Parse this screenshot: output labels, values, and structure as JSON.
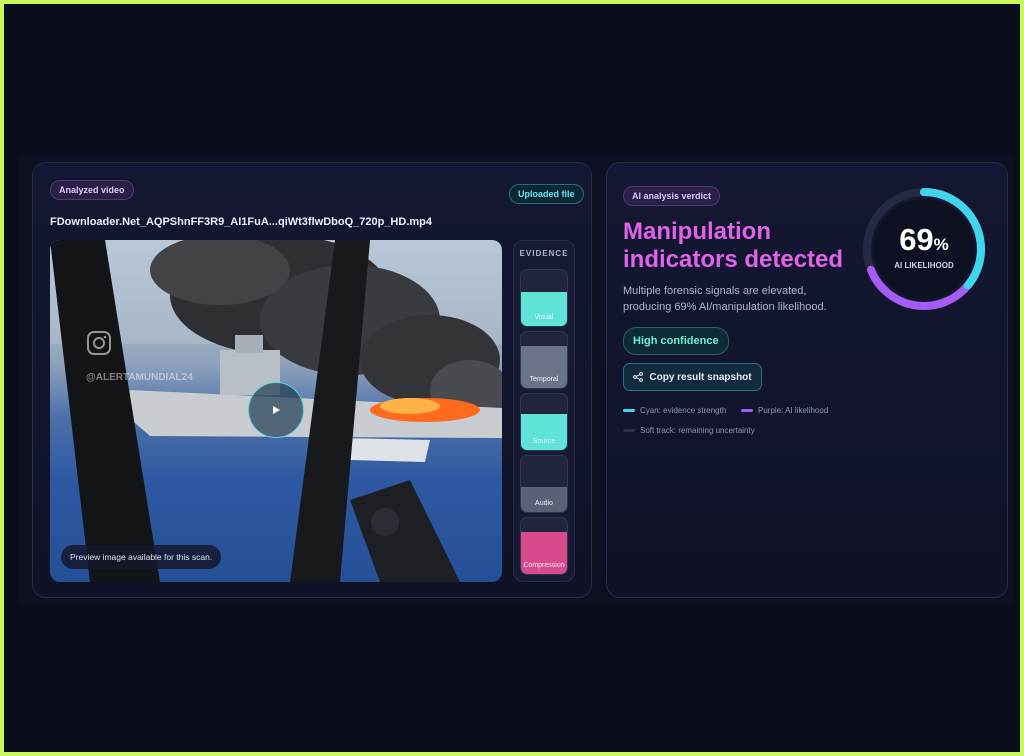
{
  "video_panel": {
    "analyzed_label": "Analyzed video",
    "source_label": "Uploaded file",
    "filename": "FDownloader.Net_AQPShnFF3R9_AI1FuA...qiWt3flwDboQ_720p_HD.mp4",
    "watermark": "@ALERTAMUNDIAL24",
    "caption": "Preview image available for this scan."
  },
  "evidence": {
    "title": "EVIDENCE",
    "items": [
      {
        "label": "Visual",
        "level": 0.6,
        "color": "#5fe3d6"
      },
      {
        "label": "Temporal",
        "level": 0.75,
        "color": "#6b7389"
      },
      {
        "label": "Source",
        "level": 0.65,
        "color": "#5fe3d6"
      },
      {
        "label": "Audio",
        "level": 0.45,
        "color": "#5a6075"
      },
      {
        "label": "Compression",
        "level": 0.75,
        "color": "#d94a8c"
      }
    ]
  },
  "verdict": {
    "tag": "AI analysis verdict",
    "title": "Manipulation indicators detected",
    "description": "Multiple forensic signals are elevated, producing 69% AI/manipulation likelihood.",
    "confidence": "High confidence",
    "copy_button": "Copy result snapshot",
    "legend": {
      "cyan": "Cyan: evidence strength",
      "purple": "Purple: AI likelihood",
      "soft": "Soft track: remaining uncertainty"
    }
  },
  "gauge": {
    "value": "69",
    "unit": "%",
    "label": "AI LIKELIHOOD",
    "likelihood": 0.69,
    "evidence_strength": 0.36
  },
  "colors": {
    "cyan": "#3fd6ec",
    "purple": "#a55cf5",
    "accent_title": "#e063e8",
    "frame": "#c8f75a"
  },
  "icons": {
    "play": "play-icon",
    "share": "share-icon",
    "instagram": "instagram-icon"
  }
}
